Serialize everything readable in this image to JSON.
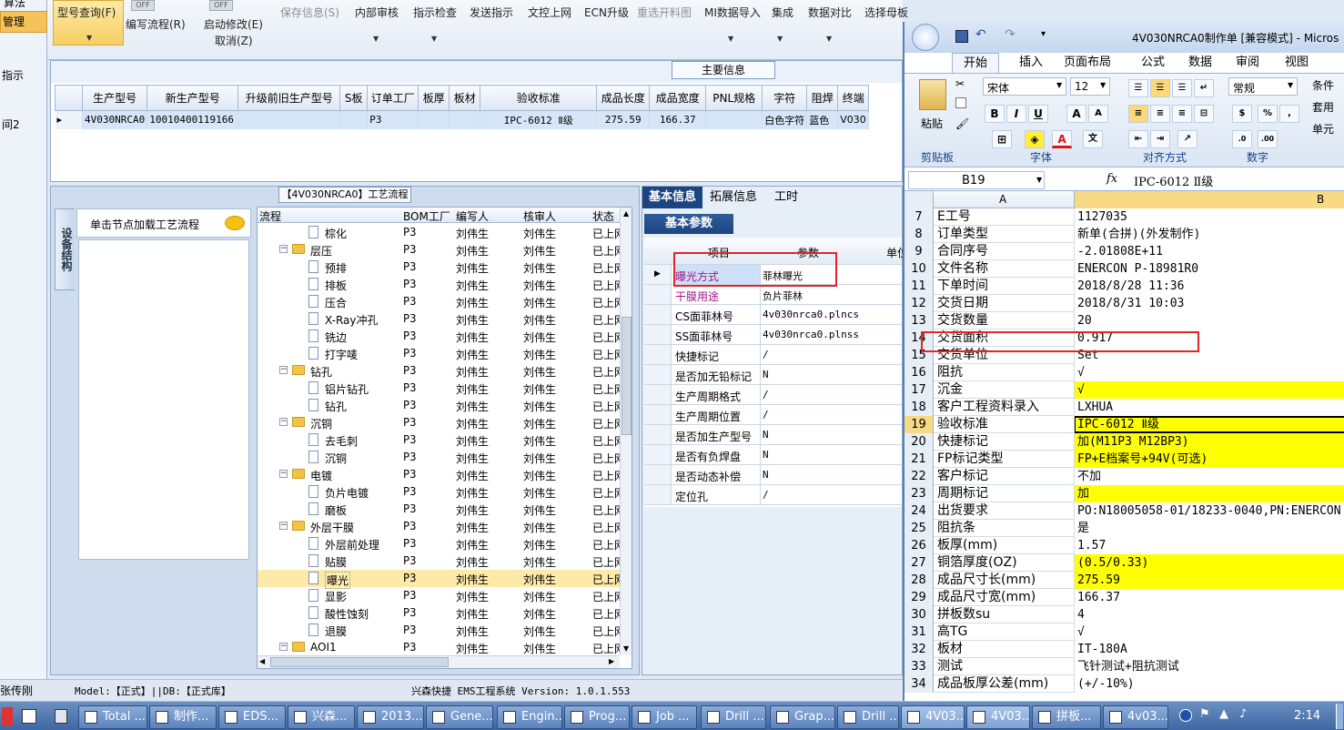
{
  "leftnav": {
    "top_item": "算法",
    "active_item": "管理",
    "item_zhishi": "指示",
    "item_2": "间2"
  },
  "toolbar": {
    "model_query": "型号查询(F)",
    "write_flow": "编写流程(R)",
    "start_modify": "启动修改(E)",
    "cancel": "取消(Z)",
    "save_info": "保存信息(S)",
    "internal_review": "内部审核",
    "indicator_check": "指示检查",
    "send_indicator": "发送指示",
    "doc_upload": "文控上网",
    "ecn_upgrade": "ECN升级",
    "reselect_drawing": "重选开料图",
    "mi_import": "MI数据导入",
    "integrate": "集成",
    "data_compare": "数据对比",
    "select_master": "选择母板",
    "toggle1": "OFF",
    "toggle2": "OFF"
  },
  "main_info": {
    "title": "主要信息",
    "columns": [
      "生产型号",
      "新生产型号",
      "升级前旧生产型号",
      "S板",
      "订单工厂",
      "板厚",
      "板材",
      "验收标准",
      "成品长度",
      "成品宽度",
      "PNL规格",
      "字符",
      "阻焊",
      "终端"
    ],
    "row": [
      "4V030NRCA0",
      "10010400119166",
      "",
      "",
      "P3",
      "",
      "",
      "IPC-6012 Ⅱ级",
      "275.59",
      "166.37",
      "",
      "白色字符",
      "蓝色",
      "V030"
    ]
  },
  "process": {
    "title": "【4V030NRCA0】工艺流程",
    "side_tab": "设备结构",
    "load_hint": "单击节点加载工艺流程",
    "columns": [
      "流程",
      "BOM工厂",
      "编写人",
      "核审人",
      "状态"
    ],
    "rows": [
      {
        "name": "棕化",
        "level": 2,
        "bom": "P3",
        "writer": "刘伟生",
        "reviewer": "刘伟生",
        "status": "已上网"
      },
      {
        "name": "层压",
        "level": 1,
        "bom": "P3",
        "writer": "刘伟生",
        "reviewer": "刘伟生",
        "status": "已上网"
      },
      {
        "name": "预排",
        "level": 2,
        "bom": "P3",
        "writer": "刘伟生",
        "reviewer": "刘伟生",
        "status": "已上网"
      },
      {
        "name": "排板",
        "level": 2,
        "bom": "P3",
        "writer": "刘伟生",
        "reviewer": "刘伟生",
        "status": "已上网"
      },
      {
        "name": "压合",
        "level": 2,
        "bom": "P3",
        "writer": "刘伟生",
        "reviewer": "刘伟生",
        "status": "已上网"
      },
      {
        "name": "X-Ray冲孔",
        "level": 2,
        "bom": "P3",
        "writer": "刘伟生",
        "reviewer": "刘伟生",
        "status": "已上网"
      },
      {
        "name": "铣边",
        "level": 2,
        "bom": "P3",
        "writer": "刘伟生",
        "reviewer": "刘伟生",
        "status": "已上网"
      },
      {
        "name": "打字唛",
        "level": 2,
        "bom": "P3",
        "writer": "刘伟生",
        "reviewer": "刘伟生",
        "status": "已上网"
      },
      {
        "name": "钻孔",
        "level": 1,
        "bom": "P3",
        "writer": "刘伟生",
        "reviewer": "刘伟生",
        "status": "已上网"
      },
      {
        "name": "铝片钻孔",
        "level": 2,
        "bom": "P3",
        "writer": "刘伟生",
        "reviewer": "刘伟生",
        "status": "已上网"
      },
      {
        "name": "钻孔",
        "level": 2,
        "bom": "P3",
        "writer": "刘伟生",
        "reviewer": "刘伟生",
        "status": "已上网"
      },
      {
        "name": "沉铜",
        "level": 1,
        "bom": "P3",
        "writer": "刘伟生",
        "reviewer": "刘伟生",
        "status": "已上网"
      },
      {
        "name": "去毛刺",
        "level": 2,
        "bom": "P3",
        "writer": "刘伟生",
        "reviewer": "刘伟生",
        "status": "已上网"
      },
      {
        "name": "沉铜",
        "level": 2,
        "bom": "P3",
        "writer": "刘伟生",
        "reviewer": "刘伟生",
        "status": "已上网"
      },
      {
        "name": "电镀",
        "level": 1,
        "bom": "P3",
        "writer": "刘伟生",
        "reviewer": "刘伟生",
        "status": "已上网"
      },
      {
        "name": "负片电镀",
        "level": 2,
        "bom": "P3",
        "writer": "刘伟生",
        "reviewer": "刘伟生",
        "status": "已上网"
      },
      {
        "name": "磨板",
        "level": 2,
        "bom": "P3",
        "writer": "刘伟生",
        "reviewer": "刘伟生",
        "status": "已上网"
      },
      {
        "name": "外层干膜",
        "level": 1,
        "bom": "P3",
        "writer": "刘伟生",
        "reviewer": "刘伟生",
        "status": "已上网"
      },
      {
        "name": "外层前处理",
        "level": 2,
        "bom": "P3",
        "writer": "刘伟生",
        "reviewer": "刘伟生",
        "status": "已上网"
      },
      {
        "name": "贴膜",
        "level": 2,
        "bom": "P3",
        "writer": "刘伟生",
        "reviewer": "刘伟生",
        "status": "已上网"
      },
      {
        "name": "曝光",
        "level": 2,
        "bom": "P3",
        "writer": "刘伟生",
        "reviewer": "刘伟生",
        "status": "已上网",
        "selected": true
      },
      {
        "name": "显影",
        "level": 2,
        "bom": "P3",
        "writer": "刘伟生",
        "reviewer": "刘伟生",
        "status": "已上网"
      },
      {
        "name": "酸性蚀刻",
        "level": 2,
        "bom": "P3",
        "writer": "刘伟生",
        "reviewer": "刘伟生",
        "status": "已上网"
      },
      {
        "name": "退膜",
        "level": 2,
        "bom": "P3",
        "writer": "刘伟生",
        "reviewer": "刘伟生",
        "status": "已上网"
      },
      {
        "name": "AOI1",
        "level": 1,
        "bom": "P3",
        "writer": "刘伟生",
        "reviewer": "刘伟生",
        "status": "已上网"
      }
    ]
  },
  "params": {
    "tabs": [
      "基本信息",
      "拓展信息",
      "工时"
    ],
    "subtab": "基本参数",
    "col_item": "项目",
    "col_param": "参数",
    "col_unit": "单位",
    "rows": [
      {
        "k": "曝光方式",
        "v": "菲林曝光"
      },
      {
        "k": "干膜用途",
        "v": "负片菲林"
      },
      {
        "k": "CS面菲林号",
        "v": "4v030nrca0.plncs"
      },
      {
        "k": "SS面菲林号",
        "v": "4v030nrca0.plnss"
      },
      {
        "k": "快捷标记",
        "v": "/"
      },
      {
        "k": "是否加无铅标记",
        "v": "N"
      },
      {
        "k": "生产周期格式",
        "v": "/"
      },
      {
        "k": "生产周期位置",
        "v": "/"
      },
      {
        "k": "是否加生产型号",
        "v": "N"
      },
      {
        "k": "是否有负焊盘",
        "v": "N"
      },
      {
        "k": "是否动态补偿",
        "v": "N"
      },
      {
        "k": "定位孔",
        "v": "/"
      }
    ]
  },
  "status": {
    "user": "张传刚",
    "model": "Model:【正式】||DB:【正式库】",
    "system": "兴森快捷 EMS工程系统 Version: 1.0.1.553"
  },
  "excel": {
    "title": "4V030NRCA0制作单 [兼容模式] - Micros",
    "tabs": [
      "开始",
      "插入",
      "页面布局",
      "公式",
      "数据",
      "审阅",
      "视图"
    ],
    "font": "宋体",
    "font_size": "12",
    "number_format": "常规",
    "groups": [
      "剪贴板",
      "字体",
      "对齐方式",
      "数字"
    ],
    "paste": "粘贴",
    "name_box": "B19",
    "formula": "IPC-6012 Ⅱ级",
    "col_a": "A",
    "col_b": "B",
    "side_labels": [
      "条件",
      "套用",
      "单元"
    ],
    "rows": [
      {
        "n": "7",
        "a": "E工号",
        "b": "1127035",
        "y": false
      },
      {
        "n": "8",
        "a": "订单类型",
        "b": "新单(合拼)(外发制作)",
        "y": false
      },
      {
        "n": "9",
        "a": "合同序号",
        "b": "-2.01808E+11",
        "y": false
      },
      {
        "n": "10",
        "a": "文件名称",
        "b": "ENERCON P-18981R0",
        "y": false
      },
      {
        "n": "11",
        "a": "下单时间",
        "b": "2018/8/28 11:36",
        "y": false
      },
      {
        "n": "12",
        "a": "交货日期",
        "b": "2018/8/31 10:03",
        "y": false
      },
      {
        "n": "13",
        "a": "交货数量",
        "b": "20",
        "y": false
      },
      {
        "n": "14",
        "a": "交货面积",
        "b": "0.917",
        "y": false
      },
      {
        "n": "15",
        "a": "交货单位",
        "b": "Set",
        "y": false
      },
      {
        "n": "16",
        "a": "阻抗",
        "b": "√",
        "y": false
      },
      {
        "n": "17",
        "a": "沉金",
        "b": "√",
        "y": true
      },
      {
        "n": "18",
        "a": "客户工程资料录入",
        "b": "LXHUA",
        "y": false
      },
      {
        "n": "19",
        "a": "验收标准",
        "b": "IPC-6012 Ⅱ级",
        "y": true
      },
      {
        "n": "20",
        "a": "快捷标记",
        "b": "加(M11P3 M12BP3)",
        "y": true
      },
      {
        "n": "21",
        "a": "FP标记类型",
        "b": "FP+E档案号+94V(可选)",
        "y": true
      },
      {
        "n": "22",
        "a": "客户标记",
        "b": "不加",
        "y": false
      },
      {
        "n": "23",
        "a": "周期标记",
        "b": "加",
        "y": true
      },
      {
        "n": "24",
        "a": "出货要求",
        "b": "PO:N18005058-01/18233-0040,PN:ENERCON",
        "y": false
      },
      {
        "n": "25",
        "a": "阻抗条",
        "b": "是",
        "y": false
      },
      {
        "n": "26",
        "a": "板厚(mm)",
        "b": "1.57",
        "y": false
      },
      {
        "n": "27",
        "a": "铜箔厚度(OZ)",
        "b": "(0.5/0.33)",
        "y": true
      },
      {
        "n": "28",
        "a": "成品尺寸长(mm)",
        "b": "275.59",
        "y": true
      },
      {
        "n": "29",
        "a": "成品尺寸宽(mm)",
        "b": "166.37",
        "y": false
      },
      {
        "n": "30",
        "a": "拼板数su",
        "b": "4",
        "y": false
      },
      {
        "n": "31",
        "a": "高TG",
        "b": "√",
        "y": false
      },
      {
        "n": "32",
        "a": "板材",
        "b": "IT-180A",
        "y": false
      },
      {
        "n": "33",
        "a": "测试",
        "b": "飞针测试+阻抗测试",
        "y": false
      },
      {
        "n": "34",
        "a": "成品板厚公差(mm)",
        "b": "(+/-10%)",
        "y": false
      }
    ]
  },
  "taskbar": {
    "items": [
      "Total ...",
      "制作...",
      "EDS...",
      "兴森...",
      "2013...",
      "Gene...",
      "Engin...",
      "Prog...",
      "Job ...",
      "Drill ...",
      "Grap...",
      "Drill ...",
      "4V03...",
      "4V03...",
      "拼板...",
      "4v03..."
    ],
    "clock": "2:14"
  },
  "colors": {
    "yellow": "#ffff00",
    "selected_row": "#fde9a8",
    "red_box": "#e0252b",
    "accent": "#1c4480"
  }
}
